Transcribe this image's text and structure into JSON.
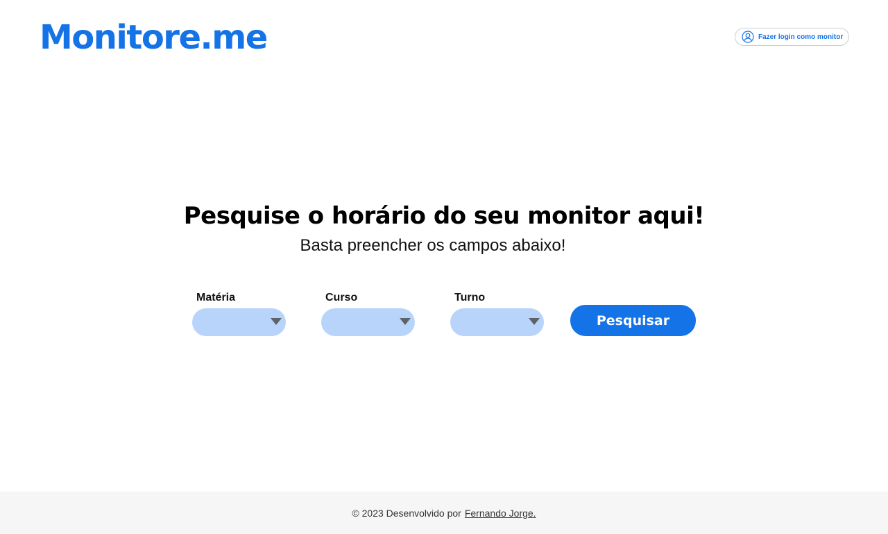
{
  "header": {
    "logo_text": "Monitore.me",
    "login_button_label": "Fazer login como monitor",
    "login_icon": "user-circle-icon"
  },
  "hero": {
    "title": "Pesquise o horário do seu monitor aqui!",
    "subtitle": "Basta preencher os campos abaixo!"
  },
  "search_form": {
    "fields": [
      {
        "label": "Matéria",
        "value": ""
      },
      {
        "label": "Curso",
        "value": ""
      },
      {
        "label": "Turno",
        "value": ""
      }
    ],
    "submit_label": "Pesquisar"
  },
  "footer": {
    "text": "© 2023 Desenvolvido por",
    "author_link": "Fernando Jorge."
  },
  "colors": {
    "brand": "#1473e6",
    "select_bg": "#b8d4fb",
    "footer_bg": "#f6f6f6"
  }
}
